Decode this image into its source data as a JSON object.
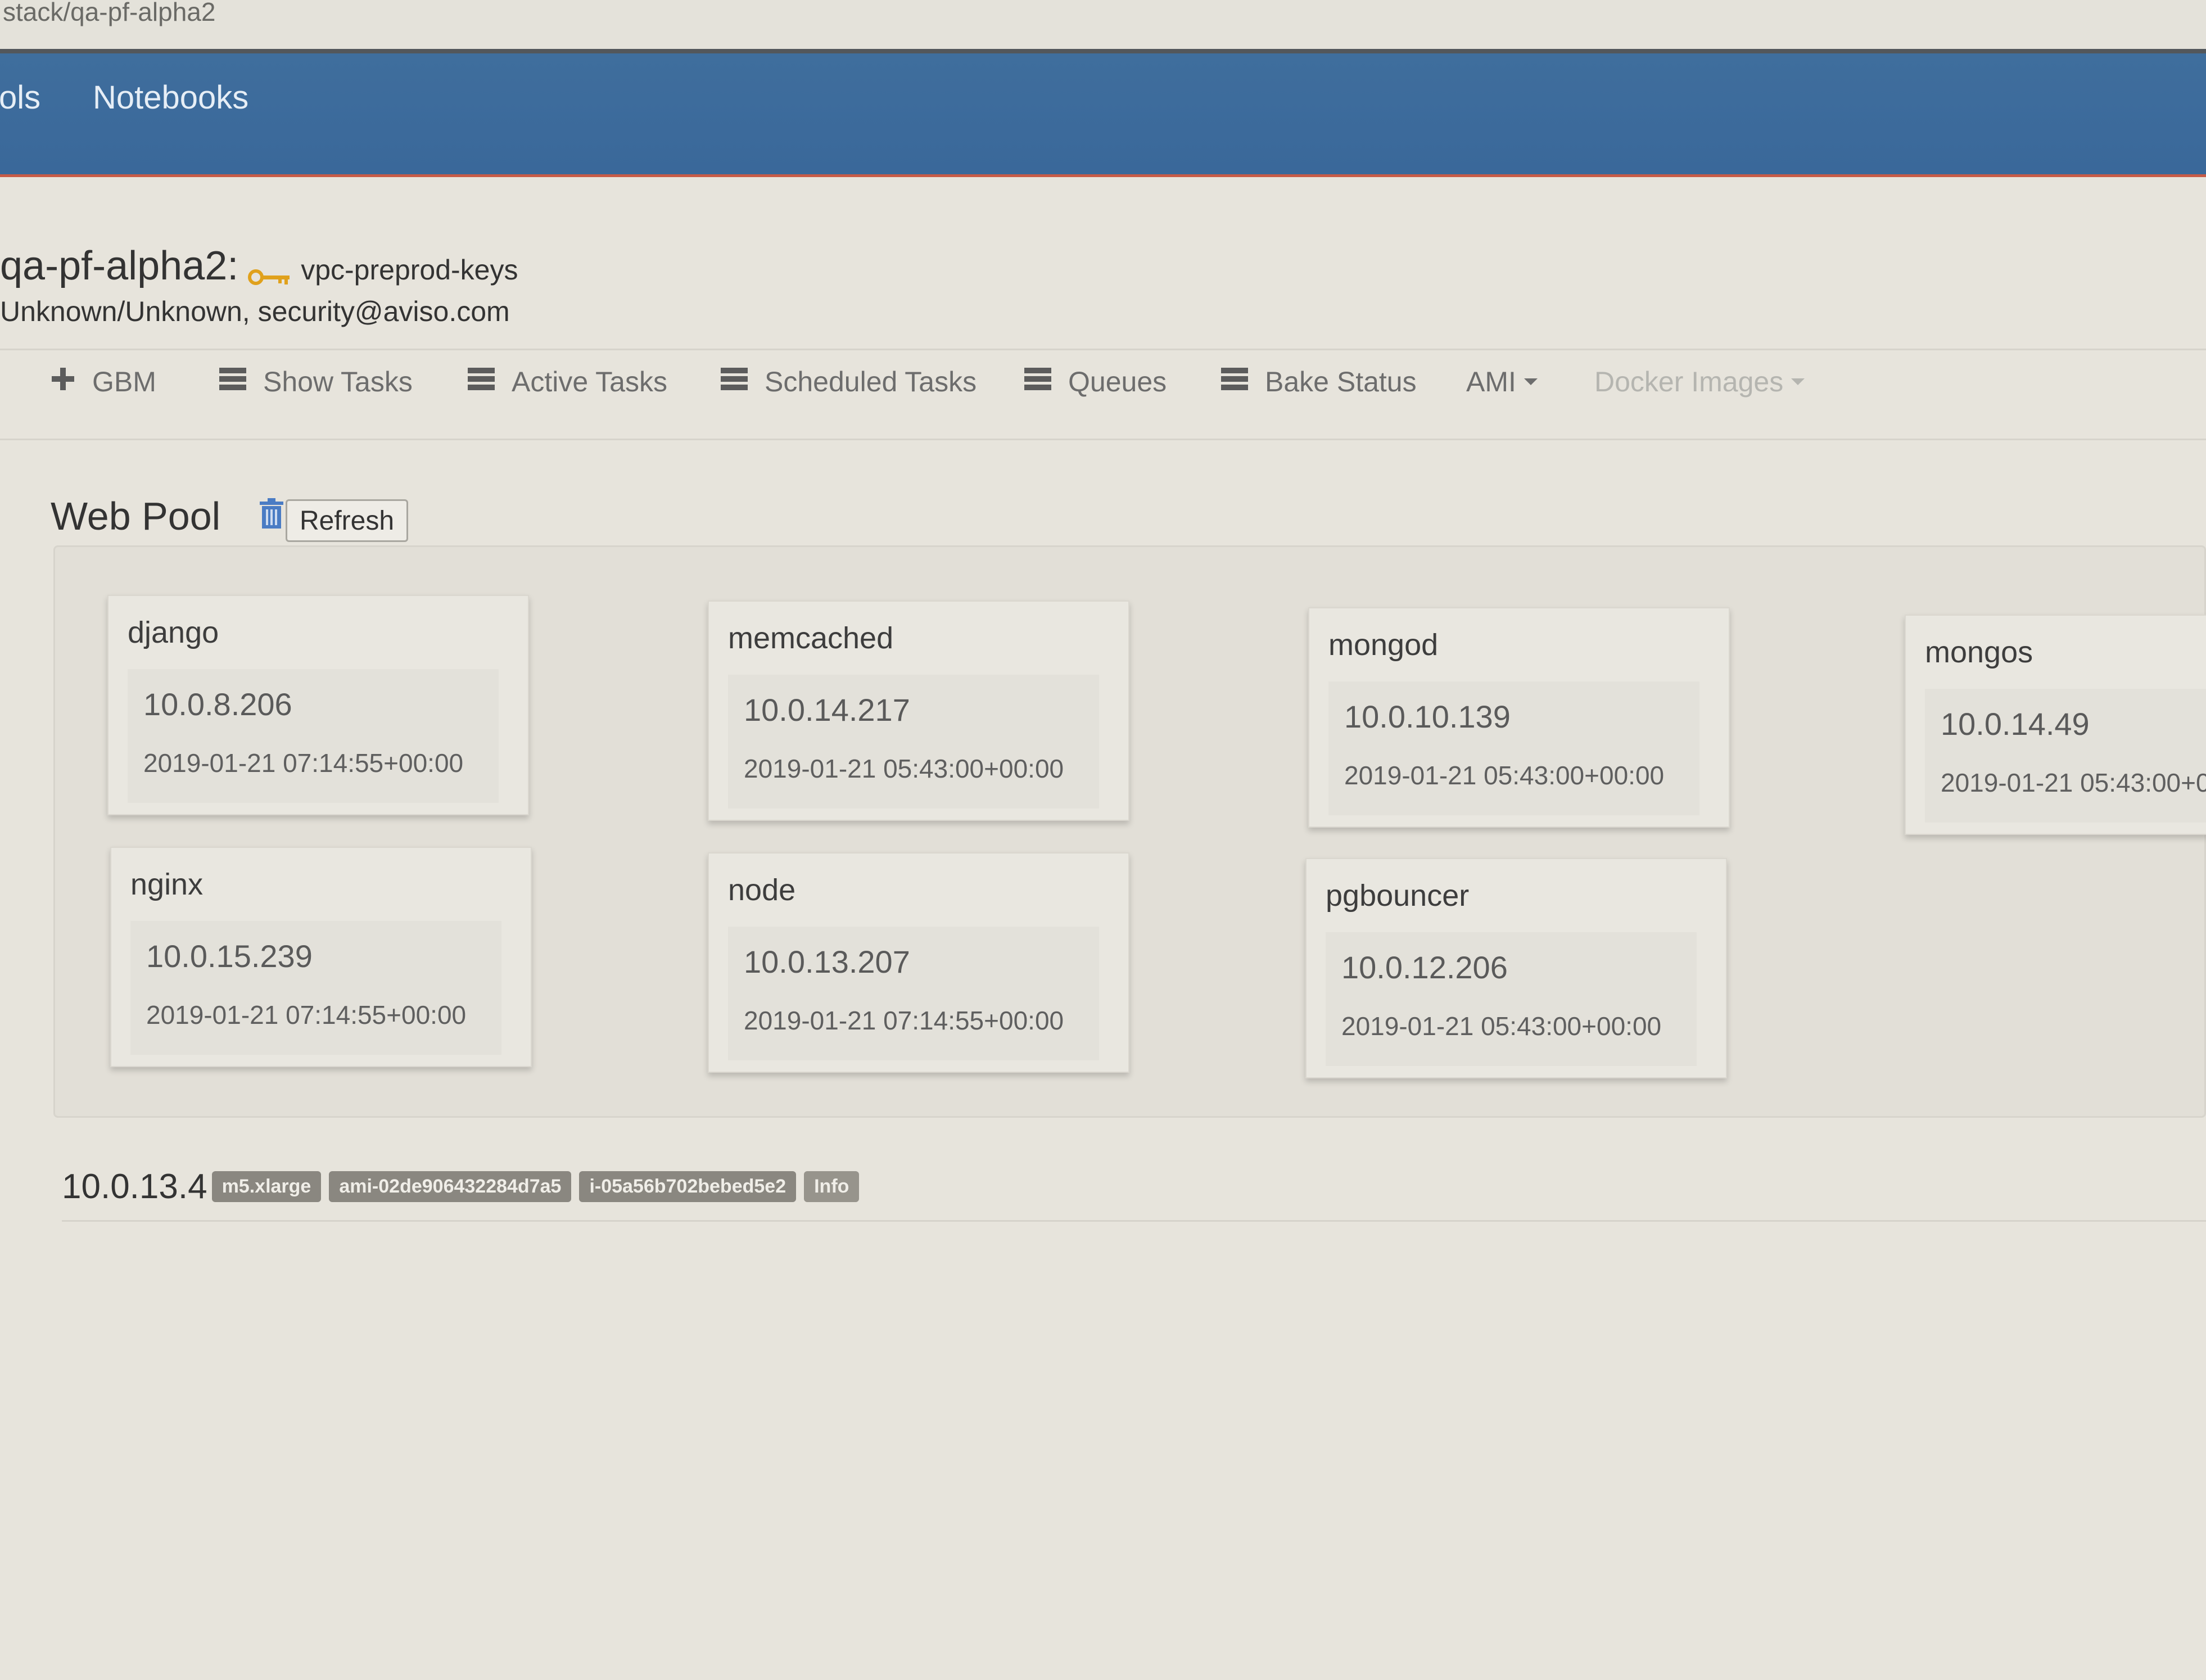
{
  "browser": {
    "url": "stack/qa-pf-alpha2"
  },
  "navbar": {
    "items": [
      {
        "label": "ols"
      },
      {
        "label": "Notebooks"
      }
    ]
  },
  "stack": {
    "name": "qa-pf-alpha2:",
    "key_name": "vpc-preprod-keys",
    "owner": "Unknown/Unknown, security@aviso.com"
  },
  "tabs": [
    {
      "label": "GBM",
      "icon": "plus-icon"
    },
    {
      "label": "Show Tasks",
      "icon": "list-icon"
    },
    {
      "label": "Active Tasks",
      "icon": "list-icon"
    },
    {
      "label": "Scheduled Tasks",
      "icon": "list-icon"
    },
    {
      "label": "Queues",
      "icon": "list-icon"
    },
    {
      "label": "Bake Status",
      "icon": "list-icon"
    },
    {
      "label": "AMI",
      "icon": "caret-down-icon"
    },
    {
      "label": "Docker Images",
      "icon": "caret-down-icon",
      "disabled": true
    }
  ],
  "pool": {
    "title": "Web Pool",
    "refresh_label": "Refresh",
    "services": [
      {
        "name": "django",
        "ip": "10.0.8.206",
        "timestamp": "2019-01-21 07:14:55+00:00"
      },
      {
        "name": "memcached",
        "ip": "10.0.14.217",
        "timestamp": "2019-01-21 05:43:00+00:00"
      },
      {
        "name": "mongod",
        "ip": "10.0.10.139",
        "timestamp": "2019-01-21 05:43:00+00:00"
      },
      {
        "name": "mongos",
        "ip": "10.0.14.49",
        "timestamp": "2019-01-21 05:43:00+0"
      },
      {
        "name": "nginx",
        "ip": "10.0.15.239",
        "timestamp": "2019-01-21 07:14:55+00:00"
      },
      {
        "name": "node",
        "ip": "10.0.13.207",
        "timestamp": "2019-01-21 07:14:55+00:00"
      },
      {
        "name": "pgbouncer",
        "ip": "10.0.12.206",
        "timestamp": "2019-01-21 05:43:00+00:00"
      }
    ]
  },
  "instance": {
    "ip": "10.0.13.4",
    "instance_type": "m5.xlarge",
    "ami": "ami-02de906432284d7a5",
    "instance_id": "i-05a56b702bebed5e2",
    "info_label": "Info"
  },
  "colors": {
    "navbar": "#3d6b9b",
    "navbar_border": "#c75b47",
    "page_background": "#e7e4dc",
    "card_background": "#e9e7e0",
    "badge": "#8a8780"
  }
}
